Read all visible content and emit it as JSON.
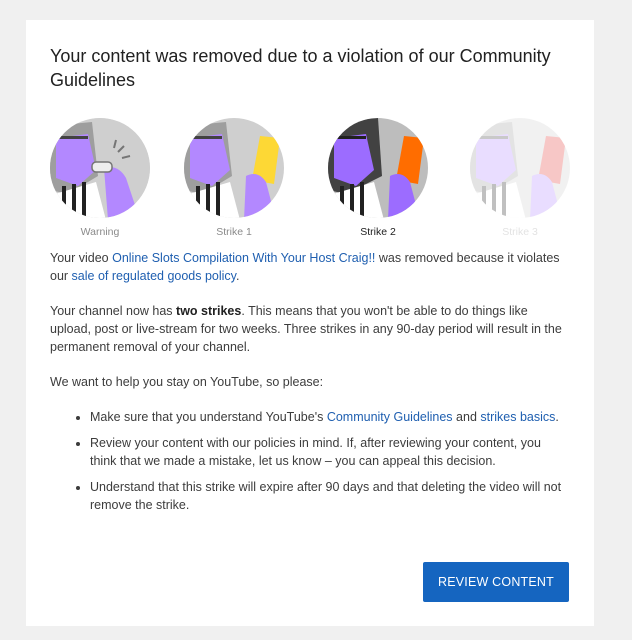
{
  "dialog": {
    "title": "Your content was removed due to a violation of our Community Guidelines"
  },
  "strikes": [
    {
      "label": "Warning",
      "icon": "warning-whistle-icon",
      "card_color": ""
    },
    {
      "label": "Strike 1",
      "icon": "yellow-card-icon",
      "card_color": "#fdd835"
    },
    {
      "label": "Strike 2",
      "icon": "orange-card-icon",
      "card_color": "#ff6d00"
    },
    {
      "label": "Strike 3",
      "icon": "red-card-icon",
      "card_color": "#e53935"
    }
  ],
  "message": {
    "p1_before": "Your video ",
    "video_title": "Online Slots Compilation With Your Host Craig!!",
    "p1_middle": " was removed because it violates our ",
    "policy_link": "sale of regulated goods policy",
    "p1_end": ".",
    "p2_before": "Your channel now has ",
    "p2_bold": "two strikes",
    "p2_after": ". This means that you won't be able to do things like upload, post or live-stream for two weeks. Three strikes in any 90-day period will result in the permanent removal of your channel.",
    "p3": "We want to help you stay on YouTube, so please:",
    "b1_before": "Make sure that you understand YouTube's ",
    "b1_link1": "Community Guidelines",
    "b1_middle": " and ",
    "b1_link2": "strikes basics",
    "b1_end": ".",
    "b2": "Review your content with our policies in mind. If, after reviewing your content, you think that we made a mistake, let us know – you can appeal this decision.",
    "b3": "Understand that this strike will expire after 90 days and that deleting the video will not remove the strike."
  },
  "actions": {
    "review_label": "REVIEW CONTENT"
  },
  "colors": {
    "accent": "#1565c0",
    "link": "#1f5fb0",
    "purple": "#b388ff"
  }
}
